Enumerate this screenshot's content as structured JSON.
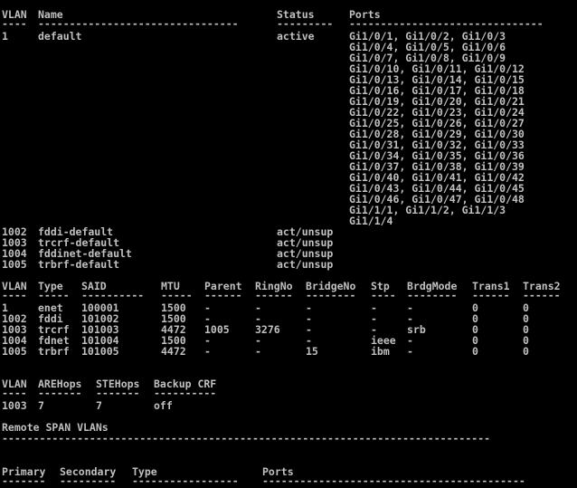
{
  "terminal": {
    "colors": {
      "background": "#000000",
      "text": "#c0c0c0"
    },
    "vlan_brief": {
      "headers": {
        "vlan": "VLAN",
        "name": "Name",
        "status": "Status",
        "ports": "Ports"
      },
      "underline": {
        "vlan": "----",
        "name": "--------------------------------",
        "status": "---------",
        "ports": "-------------------------------"
      },
      "rows": [
        {
          "vlan": "1",
          "name": "default",
          "status": "active",
          "ports": "Gi1/0/1, Gi1/0/2, Gi1/0/3"
        },
        {
          "vlan": "",
          "name": "",
          "status": "",
          "ports": "Gi1/0/4, Gi1/0/5, Gi1/0/6"
        },
        {
          "vlan": "",
          "name": "",
          "status": "",
          "ports": "Gi1/0/7, Gi1/0/8, Gi1/0/9"
        },
        {
          "vlan": "",
          "name": "",
          "status": "",
          "ports": "Gi1/0/10, Gi1/0/11, Gi1/0/12"
        },
        {
          "vlan": "",
          "name": "",
          "status": "",
          "ports": "Gi1/0/13, Gi1/0/14, Gi1/0/15"
        },
        {
          "vlan": "",
          "name": "",
          "status": "",
          "ports": "Gi1/0/16, Gi1/0/17, Gi1/0/18"
        },
        {
          "vlan": "",
          "name": "",
          "status": "",
          "ports": "Gi1/0/19, Gi1/0/20, Gi1/0/21"
        },
        {
          "vlan": "",
          "name": "",
          "status": "",
          "ports": "Gi1/0/22, Gi1/0/23, Gi1/0/24"
        },
        {
          "vlan": "",
          "name": "",
          "status": "",
          "ports": "Gi1/0/25, Gi1/0/26, Gi1/0/27"
        },
        {
          "vlan": "",
          "name": "",
          "status": "",
          "ports": "Gi1/0/28, Gi1/0/29, Gi1/0/30"
        },
        {
          "vlan": "",
          "name": "",
          "status": "",
          "ports": "Gi1/0/31, Gi1/0/32, Gi1/0/33"
        },
        {
          "vlan": "",
          "name": "",
          "status": "",
          "ports": "Gi1/0/34, Gi1/0/35, Gi1/0/36"
        },
        {
          "vlan": "",
          "name": "",
          "status": "",
          "ports": "Gi1/0/37, Gi1/0/38, Gi1/0/39"
        },
        {
          "vlan": "",
          "name": "",
          "status": "",
          "ports": "Gi1/0/40, Gi1/0/41, Gi1/0/42"
        },
        {
          "vlan": "",
          "name": "",
          "status": "",
          "ports": "Gi1/0/43, Gi1/0/44, Gi1/0/45"
        },
        {
          "vlan": "",
          "name": "",
          "status": "",
          "ports": "Gi1/0/46, Gi1/0/47, Gi1/0/48"
        },
        {
          "vlan": "",
          "name": "",
          "status": "",
          "ports": "Gi1/1/1, Gi1/1/2, Gi1/1/3"
        },
        {
          "vlan": "",
          "name": "",
          "status": "",
          "ports": "Gi1/1/4"
        },
        {
          "vlan": "1002",
          "name": "fddi-default",
          "status": "act/unsup",
          "ports": ""
        },
        {
          "vlan": "1003",
          "name": "trcrf-default",
          "status": "act/unsup",
          "ports": ""
        },
        {
          "vlan": "1004",
          "name": "fddinet-default",
          "status": "act/unsup",
          "ports": ""
        },
        {
          "vlan": "1005",
          "name": "trbrf-default",
          "status": "act/unsup",
          "ports": ""
        }
      ]
    },
    "vlan_detail": {
      "headers": {
        "vlan": "VLAN",
        "type": "Type",
        "said": "SAID",
        "mtu": "MTU",
        "parent": "Parent",
        "ringno": "RingNo",
        "bridgeno": "BridgeNo",
        "stp": "Stp",
        "brdgmode": "BrdgMode",
        "trans1": "Trans1",
        "trans2": "Trans2"
      },
      "underline": {
        "vlan": "----",
        "type": "-----",
        "said": "----------",
        "mtu": "-----",
        "parent": "------",
        "ringno": "------",
        "bridgeno": "--------",
        "stp": "----",
        "brdgmode": "--------",
        "trans1": "------",
        "trans2": "------"
      },
      "rows": [
        {
          "vlan": "1",
          "type": "enet",
          "said": "100001",
          "mtu": "1500",
          "parent": "-",
          "ringno": "-",
          "bridgeno": "-",
          "stp": "-",
          "brdgmode": "-",
          "trans1": "0",
          "trans2": "0"
        },
        {
          "vlan": "1002",
          "type": "fddi",
          "said": "101002",
          "mtu": "1500",
          "parent": "-",
          "ringno": "-",
          "bridgeno": "-",
          "stp": "-",
          "brdgmode": "-",
          "trans1": "0",
          "trans2": "0"
        },
        {
          "vlan": "1003",
          "type": "trcrf",
          "said": "101003",
          "mtu": "4472",
          "parent": "1005",
          "ringno": "3276",
          "bridgeno": "-",
          "stp": "-",
          "brdgmode": "srb",
          "trans1": "0",
          "trans2": "0"
        },
        {
          "vlan": "1004",
          "type": "fdnet",
          "said": "101004",
          "mtu": "1500",
          "parent": "-",
          "ringno": "-",
          "bridgeno": "-",
          "stp": "ieee",
          "brdgmode": "-",
          "trans1": "0",
          "trans2": "0"
        },
        {
          "vlan": "1005",
          "type": "trbrf",
          "said": "101005",
          "mtu": "4472",
          "parent": "-",
          "ringno": "-",
          "bridgeno": "15",
          "stp": "ibm",
          "brdgmode": "-",
          "trans1": "0",
          "trans2": "0"
        }
      ]
    },
    "are_hops": {
      "headers": {
        "vlan": "VLAN",
        "arehops": "AREHops",
        "stehops": "STEHops",
        "backup": "Backup CRF"
      },
      "underline": {
        "vlan": "----",
        "arehops": "-------",
        "stehops": "-------",
        "backup": "----------"
      },
      "rows": [
        {
          "vlan": "1003",
          "arehops": "7",
          "stehops": "7",
          "backup": "off"
        }
      ]
    },
    "remote_span": {
      "title": "Remote SPAN VLANs",
      "underline": "------------------------------------------------------------------------------"
    },
    "private_vlan": {
      "headers": {
        "primary": "Primary",
        "secondary": "Secondary",
        "type": "Type",
        "ports": "Ports"
      },
      "underline": {
        "primary": "-------",
        "secondary": "---------",
        "type": "-----------------",
        "ports": "------------------------------------------"
      }
    }
  }
}
